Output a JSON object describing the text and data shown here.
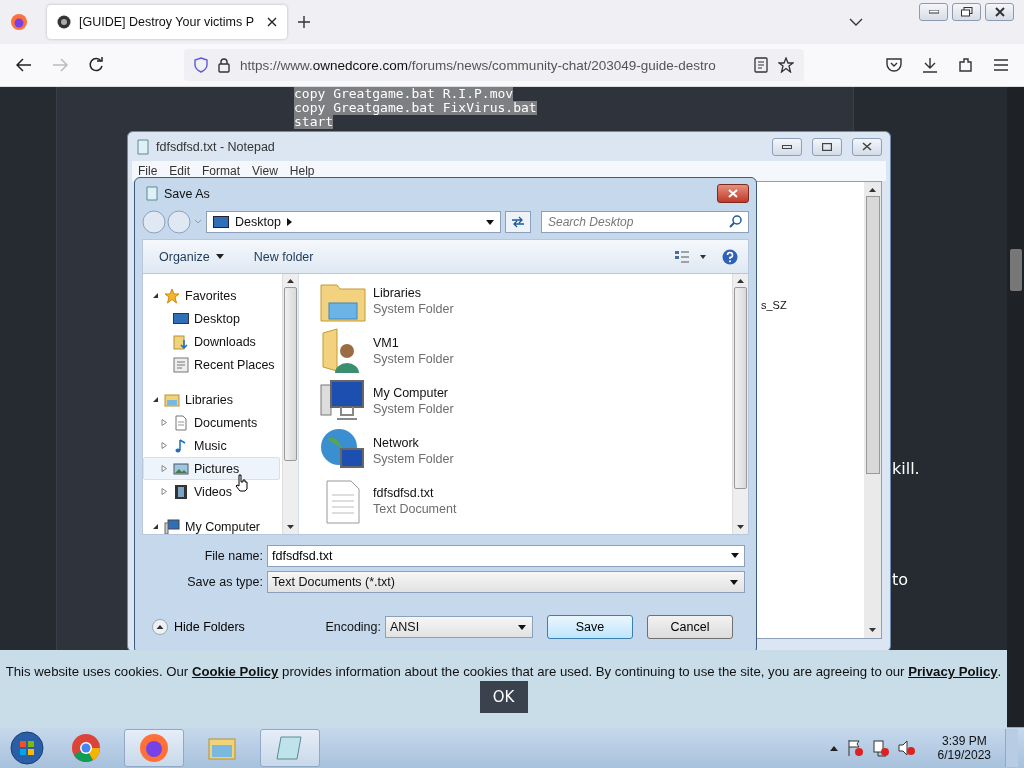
{
  "browser": {
    "tab": {
      "title": "[GUIDE] Destroy Your victims P",
      "selected": true
    },
    "url": {
      "prefix": "https://www.",
      "domain": "ownedcore.com",
      "path": "/forums/news/community-chat/203049-guide-destro"
    }
  },
  "page": {
    "code_lines": [
      "copy Greatgame.bat R.I.P.mov",
      "copy Greatgame.bat FixVirus.bat",
      "start"
    ],
    "side_text": [
      "kill.",
      "to"
    ]
  },
  "notepad": {
    "title": "fdfsdfsd.txt - Notepad",
    "menu": [
      "File",
      "Edit",
      "Format",
      "View",
      "Help"
    ],
    "text_fragment": "s_SZ"
  },
  "save_dialog": {
    "title": "Save As",
    "location": "Desktop",
    "search": {
      "placeholder": "Search Desktop"
    },
    "toolbar": [
      "Organize",
      "New folder"
    ],
    "tree": [
      {
        "label": "Favorites",
        "kind": "star",
        "expanded": true,
        "selected": false,
        "children": [
          {
            "label": "Desktop",
            "kind": "desktop",
            "selected": false
          },
          {
            "label": "Downloads",
            "kind": "downloads",
            "selected": false
          },
          {
            "label": "Recent Places",
            "kind": "recent",
            "selected": false
          }
        ]
      },
      {
        "label": "Libraries",
        "kind": "library",
        "expanded": true,
        "selected": false,
        "children": [
          {
            "label": "Documents",
            "kind": "documents",
            "expanded": false,
            "selected": false
          },
          {
            "label": "Music",
            "kind": "music",
            "expanded": false,
            "selected": false
          },
          {
            "label": "Pictures",
            "kind": "pictures",
            "expanded": false,
            "selected": true
          },
          {
            "label": "Videos",
            "kind": "videos",
            "expanded": false,
            "selected": false
          }
        ]
      },
      {
        "label": "My Computer",
        "kind": "computer",
        "expanded": true,
        "selected": false
      }
    ],
    "items": [
      {
        "name": "Libraries",
        "type": "System Folder",
        "kind": "library"
      },
      {
        "name": "VM1",
        "type": "System Folder",
        "kind": "user"
      },
      {
        "name": "My Computer",
        "type": "System Folder",
        "kind": "computer"
      },
      {
        "name": "Network",
        "type": "System Folder",
        "kind": "network"
      },
      {
        "name": "fdfsdfsd.txt",
        "type": "Text Document",
        "kind": "text"
      }
    ],
    "file_name_label": "File name:",
    "file_name": "fdfsdfsd.txt",
    "type_label": "Save as type:",
    "save_type": "Text Documents (*.txt)",
    "hide_folders": "Hide Folders",
    "encoding_label": "Encoding:",
    "encoding": "ANSI",
    "buttons": [
      {
        "label": "Save",
        "default": true
      },
      {
        "label": "Cancel",
        "default": false
      }
    ]
  },
  "cookie_banner": {
    "parts": [
      {
        "kind": "text",
        "text": "This website uses cookies. Our "
      },
      {
        "kind": "link",
        "text": "Cookie Policy"
      },
      {
        "kind": "text",
        "text": " provides information about the cookies that are used. By continuing to use the site, you are agreeing to our "
      },
      {
        "kind": "link",
        "text": "Privacy Policy"
      },
      {
        "kind": "text",
        "text": "."
      }
    ],
    "ok": "OK"
  },
  "taskbar": {
    "apps": [
      {
        "kind": "chrome",
        "active": false
      },
      {
        "kind": "firefox",
        "active": true
      },
      {
        "kind": "explorer",
        "active": false
      },
      {
        "kind": "notepad",
        "active": true
      }
    ],
    "time": "3:39 PM",
    "date": "6/19/2023"
  }
}
